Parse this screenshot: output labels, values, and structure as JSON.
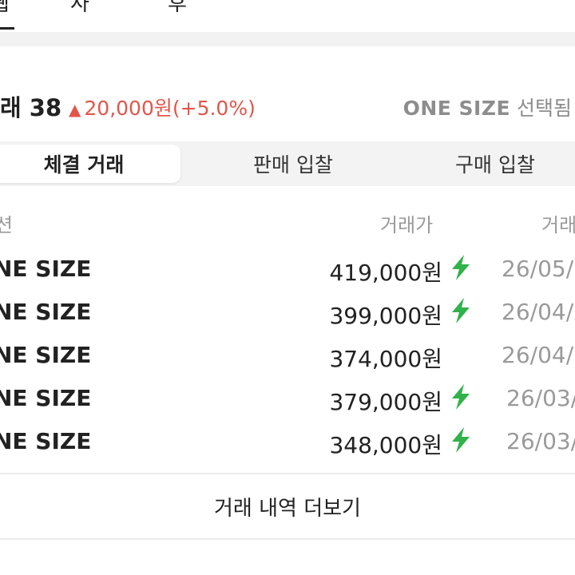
{
  "top_tabs": [
    "웹",
    "사",
    "후"
  ],
  "summary": {
    "trade_count_label": "래 38",
    "change_text": "20,000원(+5.0%)",
    "size_code": "ONE SIZE",
    "size_suffix": "선택됨",
    "change_color": "#e2564a"
  },
  "tabs": [
    {
      "label": "체결 거래",
      "active": true
    },
    {
      "label": "판매 입찰",
      "active": false
    },
    {
      "label": "구매 입찰",
      "active": false
    }
  ],
  "table": {
    "headers": [
      "션",
      "거래가",
      "거래"
    ],
    "rows": [
      {
        "size": "NE SIZE",
        "price": "419,000원",
        "fast": true,
        "date": "26/05/"
      },
      {
        "size": "NE SIZE",
        "price": "399,000원",
        "fast": true,
        "date": "26/04/"
      },
      {
        "size": "NE SIZE",
        "price": "374,000원",
        "fast": false,
        "date": "26/04/"
      },
      {
        "size": "NE SIZE",
        "price": "379,000원",
        "fast": true,
        "date": "26/03/"
      },
      {
        "size": "NE SIZE",
        "price": "348,000원",
        "fast": true,
        "date": "26/03/"
      }
    ]
  },
  "more_button_label": "거래 내역 더보기",
  "icons": {
    "up_arrow": "triangle-up-icon",
    "fast_delivery": "lightning-bolt-icon"
  },
  "colors": {
    "bolt": "#31b24a",
    "muted": "#9a9a9a"
  }
}
